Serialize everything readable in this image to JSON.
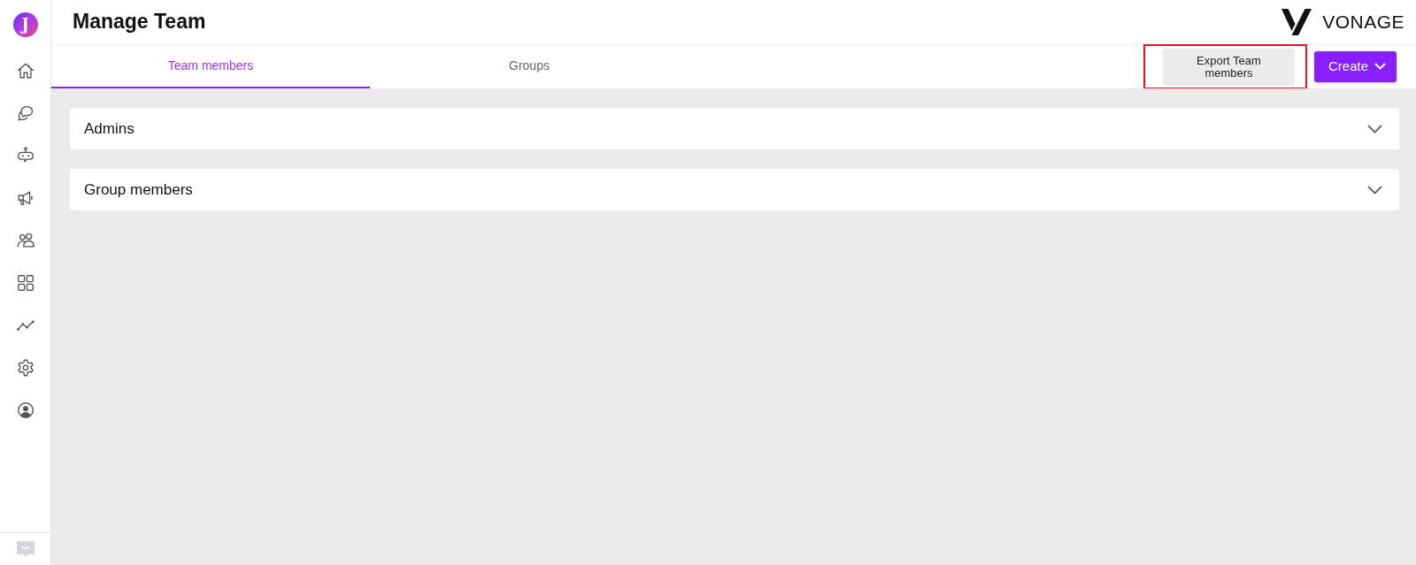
{
  "sidebar": {
    "logo_text": "J"
  },
  "header": {
    "title": "Manage Team",
    "brand": "VONAGE"
  },
  "tabs": [
    {
      "label": "Team members",
      "selected": true
    },
    {
      "label": "Groups",
      "selected": false
    }
  ],
  "actions": {
    "export": {
      "label": "Export Team members",
      "highlighted": true
    },
    "create": {
      "label": "Create"
    }
  },
  "sections": [
    {
      "title": "Admins",
      "expanded": false
    },
    {
      "title": "Group members",
      "expanded": false
    }
  ]
}
